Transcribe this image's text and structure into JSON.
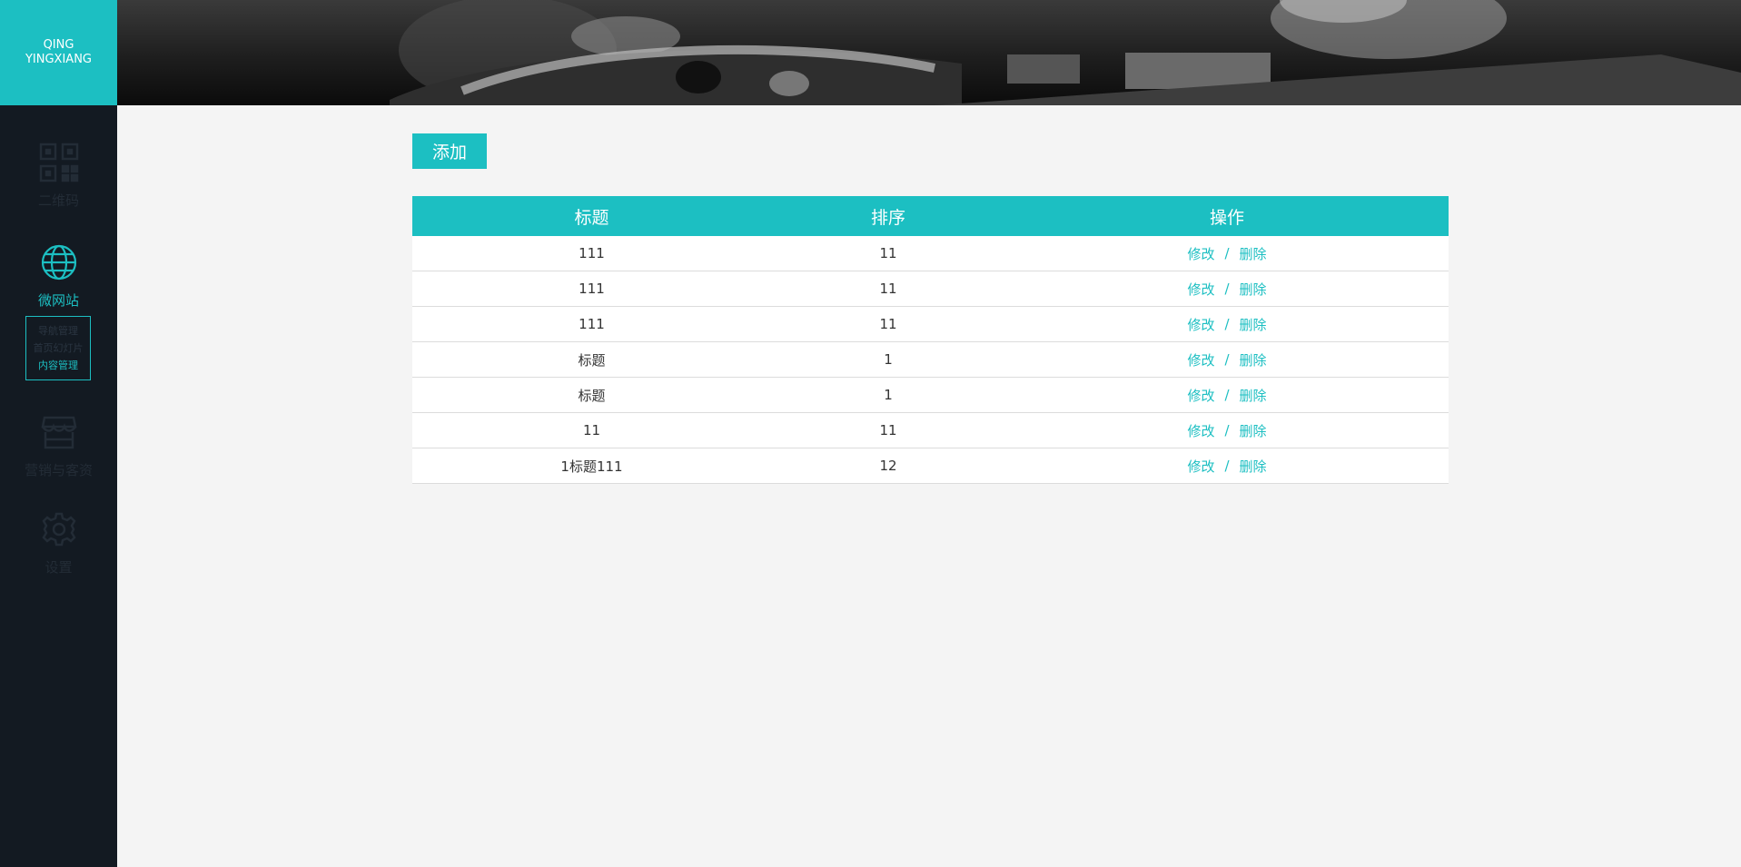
{
  "brand": {
    "line1": "QING",
    "line2": "YINGXIANG"
  },
  "sidebar": {
    "items": [
      {
        "label": "二维码",
        "icon": "qrcode-icon"
      },
      {
        "label": "微网站",
        "icon": "globe-icon"
      },
      {
        "label": "营销与客资",
        "icon": "storefront-icon"
      },
      {
        "label": "设置",
        "icon": "gear-icon"
      }
    ],
    "subitems": [
      "导航管理",
      "首页幻灯片",
      "内容管理"
    ]
  },
  "toolbar": {
    "add_label": "添加"
  },
  "table": {
    "headers": [
      "标题",
      "排序",
      "操作"
    ],
    "rows": [
      {
        "title": "111",
        "order": "11"
      },
      {
        "title": "111",
        "order": "11"
      },
      {
        "title": "111",
        "order": "11"
      },
      {
        "title": "标题",
        "order": "1"
      },
      {
        "title": "标题",
        "order": "1"
      },
      {
        "title": "11",
        "order": "11"
      },
      {
        "title": "1标题111",
        "order": "12"
      }
    ],
    "edit_label": "修改",
    "separator": "/",
    "delete_label": "删除"
  },
  "colors": {
    "accent": "#1cbfc2",
    "sidebar_bg": "#131a22",
    "content_bg": "#f4f4f4"
  }
}
